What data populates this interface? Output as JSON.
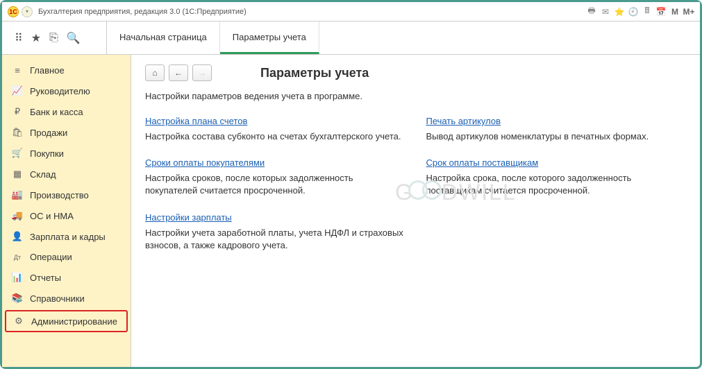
{
  "titlebar": {
    "logo": "1С",
    "title": "Бухгалтерия предприятия, редакция 3.0   (1С:Предприятие)",
    "m": "M",
    "mplus": "M+"
  },
  "tabs": [
    {
      "label": "Начальная страница",
      "active": false
    },
    {
      "label": "Параметры учета",
      "active": true
    }
  ],
  "sidebar": {
    "items": [
      {
        "icon": "≡",
        "label": "Главное"
      },
      {
        "icon": "📈",
        "label": "Руководителю"
      },
      {
        "icon": "₽",
        "label": "Банк и касса"
      },
      {
        "icon": "🛍",
        "label": "Продажи"
      },
      {
        "icon": "🛒",
        "label": "Покупки"
      },
      {
        "icon": "▦",
        "label": "Склад"
      },
      {
        "icon": "🏭",
        "label": "Производство"
      },
      {
        "icon": "🚚",
        "label": "ОС и НМА"
      },
      {
        "icon": "👤",
        "label": "Зарплата и кадры"
      },
      {
        "icon": "Дт",
        "label": "Операции"
      },
      {
        "icon": "📊",
        "label": "Отчеты"
      },
      {
        "icon": "📚",
        "label": "Справочники"
      },
      {
        "icon": "⚙",
        "label": "Администрирование",
        "selected": true
      }
    ]
  },
  "content": {
    "title": "Параметры учета",
    "subtitle": "Настройки параметров ведения учета в программе.",
    "watermark": "GOODWILL",
    "settings": [
      {
        "link": "Настройка плана счетов",
        "desc": "Настройка состава субконто на счетах бухгалтерского учета."
      },
      {
        "link": "Печать артикулов",
        "desc": "Вывод артикулов номенклатуры в печатных формах."
      },
      {
        "link": "Сроки оплаты покупателями",
        "desc": "Настройка сроков, после которых задолженность покупателей считается просроченной."
      },
      {
        "link": "Срок оплаты поставщикам",
        "desc": "Настройка срока, после которого задолженность поставщикам считается просроченной."
      },
      {
        "link": "Настройки зарплаты",
        "desc": "Настройки учета заработной платы, учета НДФЛ и страховых взносов, а также кадрового учета."
      }
    ]
  }
}
